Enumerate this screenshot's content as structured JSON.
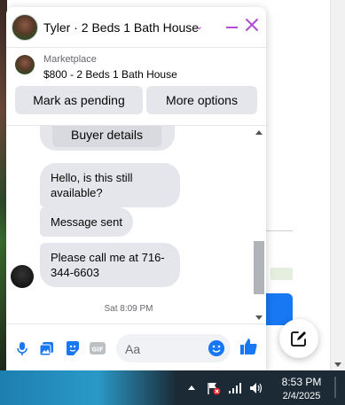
{
  "chat": {
    "title": "Tyler · 2 Beds 1 Bath House",
    "context_label": "Marketplace",
    "context_item": "$800 - 2 Beds 1 Bath House",
    "mark_pending_label": "Mark as pending",
    "more_options_label": "More options",
    "buyer_details_label": "Buyer details",
    "messages": [
      {
        "text": "Hello, is this still available?",
        "from": "other"
      },
      {
        "text": "Message sent",
        "from": "other"
      },
      {
        "text": "Please call me at 716-344-6603",
        "from": "other"
      }
    ],
    "timestamp": "Sat 8:09 PM",
    "composer_placeholder": "Aa"
  },
  "taskbar": {
    "time": "8:53 PM",
    "date": "2/4/2025"
  },
  "colors": {
    "accent": "#1877f2",
    "header_icons": "#b04cd6",
    "bubble": "#e4e6eb"
  }
}
